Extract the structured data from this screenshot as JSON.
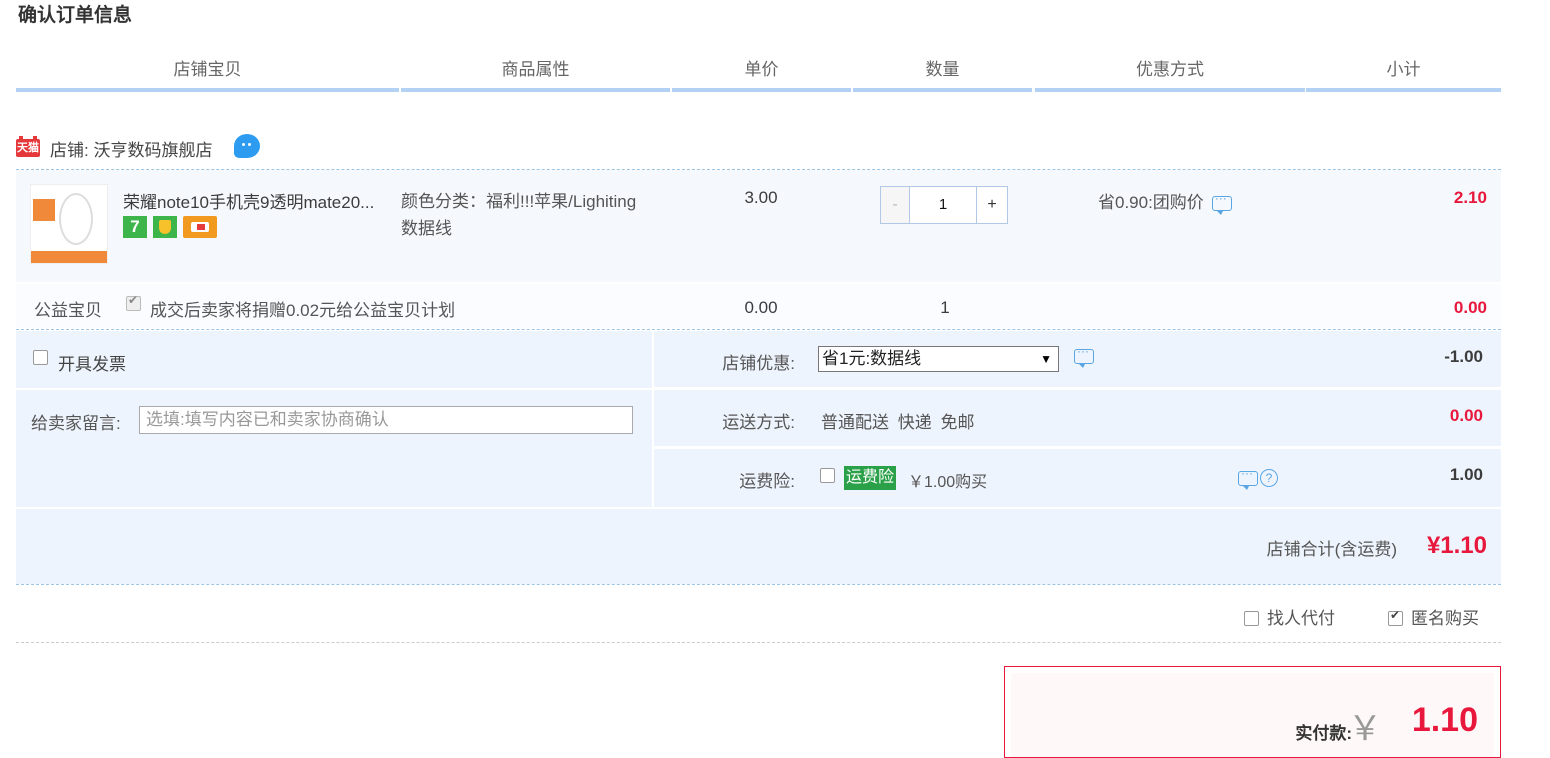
{
  "page_title": "确认订单信息",
  "columns": [
    "店铺宝贝",
    "商品属性",
    "单价",
    "数量",
    "优惠方式",
    "小计"
  ],
  "shop": {
    "badge": "天猫",
    "label": "店铺: 沃亨数码旗舰店",
    "chat_icon": "wangwang-icon"
  },
  "item": {
    "title": "荣耀note10手机壳9透明mate20...",
    "attr_line1": "颜色分类：福利!!!苹果/Lighiting",
    "attr_line2": "数据线",
    "badge_7": "7",
    "unit_price": "3.00",
    "quantity": "1",
    "qty_minus": "-",
    "qty_plus": "+",
    "discount": "省0.90:团购价",
    "subtotal": "2.10"
  },
  "charity": {
    "label": "公益宝贝",
    "text": "成交后卖家将捐赠0.02元给公益宝贝计划",
    "price": "0.00",
    "qty": "1",
    "subtotal": "0.00"
  },
  "invoice": {
    "label": "开具发票"
  },
  "message": {
    "label": "给卖家留言:",
    "placeholder": "选填:填写内容已和卖家协商确认"
  },
  "shop_discount": {
    "label": "店铺优惠:",
    "selected": "省1元:数据线",
    "value": "-1.00"
  },
  "shipping": {
    "label": "运送方式:",
    "text": "普通配送 快递 免邮",
    "value": "0.00"
  },
  "insurance": {
    "label": "运费险:",
    "badge": "运费险",
    "text": "￥1.00购买",
    "value": "1.00"
  },
  "shop_total": {
    "label": "店铺合计(含运费)",
    "value": "¥1.10"
  },
  "options": {
    "proxy_pay": "找人代付",
    "anonymous": "匿名购买"
  },
  "payment": {
    "label": "实付款:",
    "currency": "￥",
    "value": "1.10"
  },
  "colors": {
    "price_red": "#e8173c",
    "header_rule": "#b2d1f5",
    "panel_bg": "#eef4fd",
    "insurance_green": "#2aa148"
  }
}
